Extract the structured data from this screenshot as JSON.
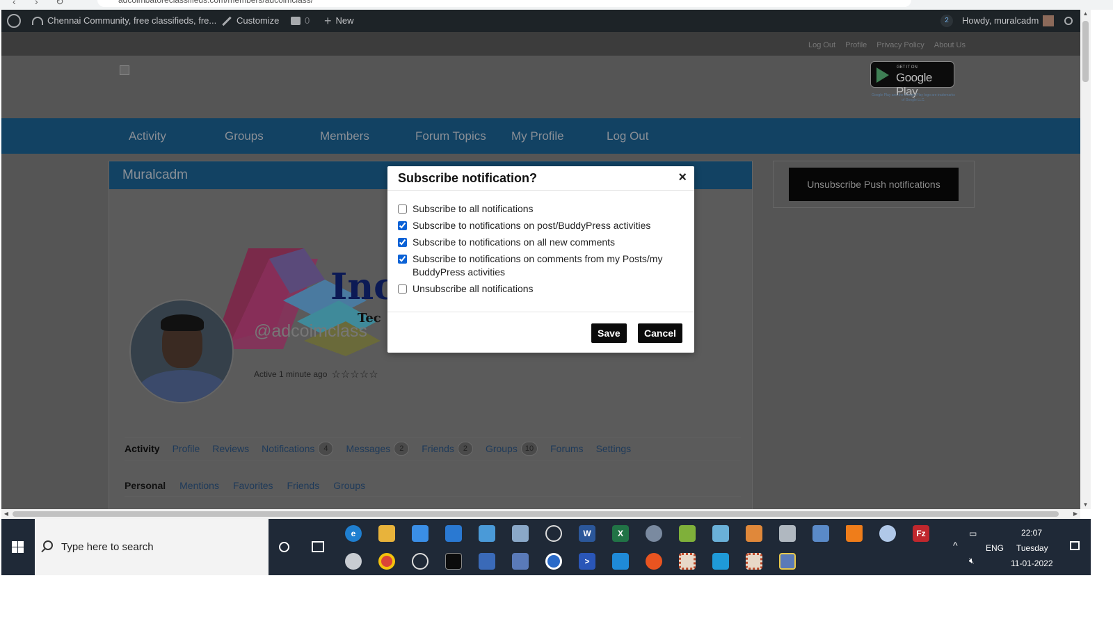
{
  "browser": {
    "url": "adcoimbatoreclassifieds.com/members/adcoimclass/"
  },
  "admin_bar": {
    "site_name": "Chennai Community, free classifieds, fre...",
    "customize": "Customize",
    "comments_count": "0",
    "new_label": "New",
    "notif_count": "2",
    "howdy": "Howdy, muralcadm"
  },
  "top_links": [
    "Log Out",
    "Profile",
    "Privacy Policy",
    "About Us"
  ],
  "google_play": {
    "small": "GET IT ON",
    "big": "Google Play",
    "legal": "Google Play and the Google Play logo are trademarks of Google LLC."
  },
  "main_nav": [
    "Activity",
    "Groups",
    "Members",
    "Forum Topics",
    "My Profile",
    "Log Out"
  ],
  "profile": {
    "title": "Muralcadm",
    "cover_brand": "Inc",
    "cover_sub": "Tec",
    "handle": "@adcoimclass",
    "active": "Active 1 minute ago",
    "stars": "☆☆☆☆☆"
  },
  "profile_tabs": [
    {
      "label": "Activity",
      "count": null,
      "current": true
    },
    {
      "label": "Profile",
      "count": null
    },
    {
      "label": "Reviews",
      "count": null
    },
    {
      "label": "Notifications",
      "count": "4"
    },
    {
      "label": "Messages",
      "count": "2"
    },
    {
      "label": "Friends",
      "count": "2"
    },
    {
      "label": "Groups",
      "count": "10"
    },
    {
      "label": "Forums",
      "count": null
    },
    {
      "label": "Settings",
      "count": null
    }
  ],
  "sub_tabs": [
    {
      "label": "Personal",
      "current": true
    },
    {
      "label": "Mentions"
    },
    {
      "label": "Favorites"
    },
    {
      "label": "Friends"
    },
    {
      "label": "Groups"
    }
  ],
  "side_button": "Unsubscribe Push notifications",
  "modal": {
    "title": "Subscribe notification?",
    "close": "×",
    "options": [
      {
        "label": "Subscribe to all notifications",
        "checked": false
      },
      {
        "label": "Subscribe to notifications on post/BuddyPress activities",
        "checked": true
      },
      {
        "label": "Subscribe to notifications on all new comments",
        "checked": true
      },
      {
        "label": "Subscribe to notifications on comments from my Posts/my BuddyPress activities",
        "checked": true
      },
      {
        "label": "Unsubscribe all notifications",
        "checked": false
      }
    ],
    "save": "Save",
    "cancel": "Cancel"
  },
  "taskbar": {
    "search_placeholder": "Type here to search",
    "lang": "ENG",
    "time": "22:07",
    "day": "Tuesday",
    "date": "11-01-2022",
    "apps_row1": [
      "edge-icon",
      "file-explorer-icon",
      "store-icon",
      "mail-icon",
      "control-panel-icon",
      "network-icon",
      "settings-icon",
      "word-icon",
      "excel-icon",
      "services-icon",
      "notepad-icon",
      "notes-icon",
      "media-player-icon",
      "scanner-icon",
      "calculator-icon",
      "vlc-icon",
      "paint-icon",
      "filezilla-icon"
    ],
    "apps_row2": [
      "disk-icon",
      "chrome-icon",
      "satellite-icon",
      "terminal-icon",
      "window-icon",
      "remote-desktop-icon",
      "app-w-icon",
      "powershell-icon",
      "vscode-icon",
      "ubuntu-icon",
      "puzzle-icon",
      "sandbox-icon",
      "puzzle2-icon",
      "network-config-icon"
    ]
  }
}
